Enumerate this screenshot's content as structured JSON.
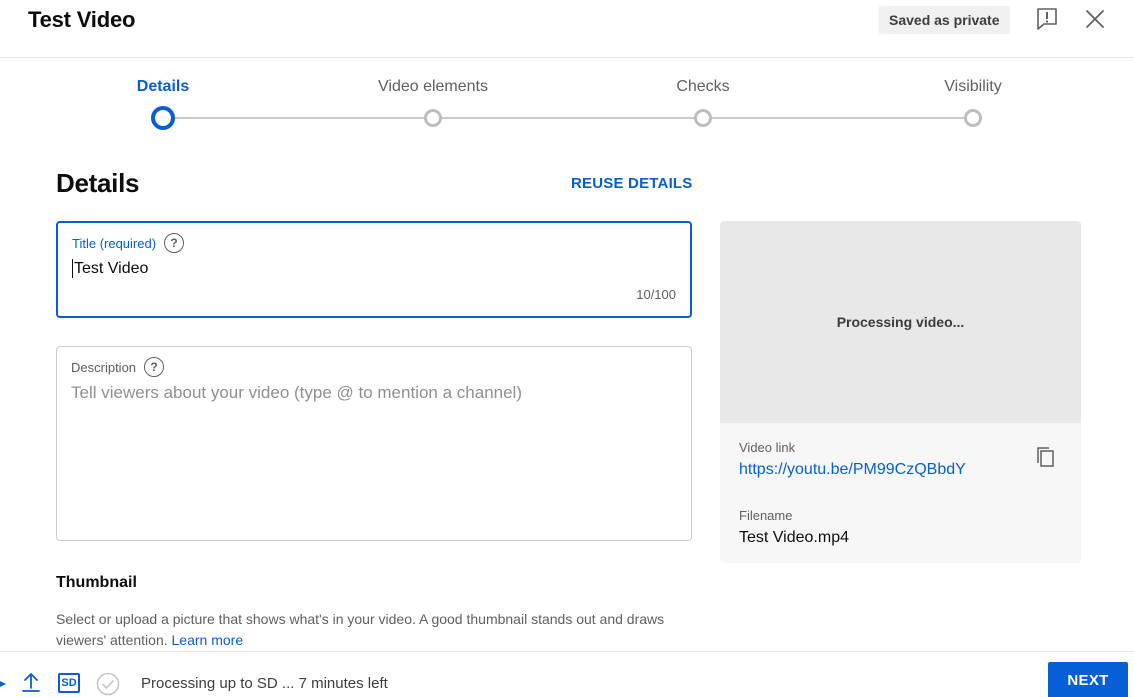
{
  "header": {
    "title": "Test Video",
    "saved_chip": "Saved as private"
  },
  "stepper": {
    "steps": [
      {
        "label": "Details",
        "active": true
      },
      {
        "label": "Video elements",
        "active": false
      },
      {
        "label": "Checks",
        "active": false
      },
      {
        "label": "Visibility",
        "active": false
      }
    ]
  },
  "details": {
    "heading": "Details",
    "reuse_label": "REUSE DETAILS",
    "title_field": {
      "label": "Title (required)",
      "value": "Test Video",
      "count": "10/100"
    },
    "description_field": {
      "label": "Description",
      "placeholder": "Tell viewers about your video (type @ to mention a channel)"
    }
  },
  "preview": {
    "status": "Processing video...",
    "video_link_label": "Video link",
    "video_link": "https://youtu.be/PM99CzQBbdY",
    "filename_label": "Filename",
    "filename": "Test Video.mp4"
  },
  "thumbnail": {
    "title": "Thumbnail",
    "description": "Select or upload a picture that shows what's in your video. A good thumbnail stands out and draws viewers' attention.",
    "learn_more": "Learn more"
  },
  "footer": {
    "sd_badge": "SD",
    "status": "Processing up to SD ... 7 minutes left",
    "next_label": "NEXT"
  },
  "colors": {
    "accent": "#065fd4",
    "preview_bg": "#e8e8e8",
    "info_bg": "#f7f7f7"
  },
  "icons": [
    "help-icon",
    "feedback-icon",
    "close-icon",
    "copy-icon",
    "upload-icon",
    "check-circle-icon"
  ]
}
